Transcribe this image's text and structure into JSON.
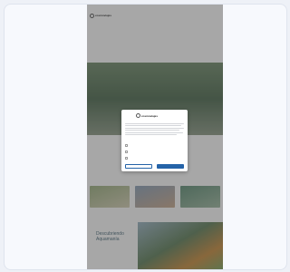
{
  "brand": {
    "name": "cosmoviajes"
  },
  "nav": {
    "links": [
      "",
      "",
      ""
    ],
    "menu": [
      "",
      "",
      "",
      "",
      "",
      "",
      ""
    ]
  },
  "hero": {
    "caption": ""
  },
  "sections": {
    "featured_title": "",
    "cards": [
      {
        "caption": ""
      },
      {
        "caption": ""
      },
      {
        "caption": ""
      }
    ],
    "promo_title": "Descubriendo Aquamanía"
  },
  "cookie_modal": {
    "title": "",
    "options": [
      {
        "label": ""
      },
      {
        "label": ""
      },
      {
        "label": ""
      }
    ],
    "buttons": {
      "secondary": "",
      "primary": ""
    }
  },
  "colors": {
    "accent": "#2563a8",
    "heading": "#4a6a7a",
    "card_bg": "#f7f9fd",
    "outer_bg": "#eef1f7"
  }
}
